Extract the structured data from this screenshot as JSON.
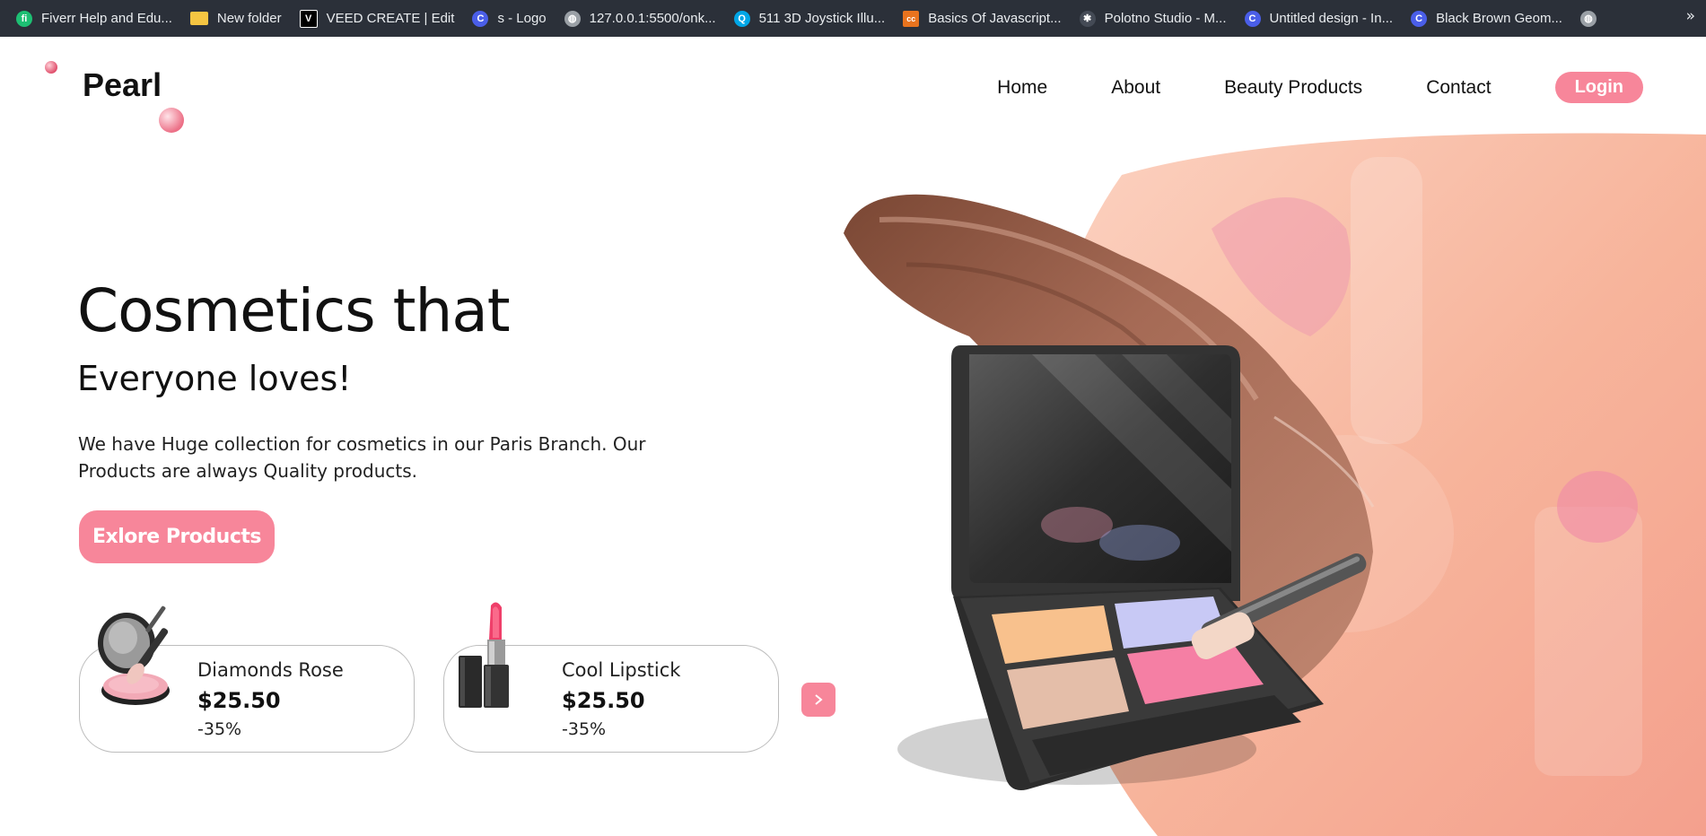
{
  "bookmarks": [
    {
      "label": "Fiverr Help and Edu...",
      "icon": "fiverr-icon",
      "color": "#1dbf73",
      "glyph": "fi"
    },
    {
      "label": "New folder",
      "icon": "folder-icon",
      "color": "#f5c542",
      "glyph": ""
    },
    {
      "label": "VEED CREATE | Edit",
      "icon": "veed-icon",
      "color": "#000000",
      "glyph": "V"
    },
    {
      "label": "s - Logo",
      "icon": "canva-icon",
      "color": "#4a5ee8",
      "glyph": "C"
    },
    {
      "label": "127.0.0.1:5500/onk...",
      "icon": "globe-icon",
      "color": "#9aa0a6",
      "glyph": ""
    },
    {
      "label": "511 3D Joystick Illu...",
      "icon": "search-site-icon",
      "color": "#00a6e6",
      "glyph": "Q"
    },
    {
      "label": "Basics Of Javascript...",
      "icon": "coursera-icon",
      "color": "#e8731e",
      "glyph": "cc"
    },
    {
      "label": "Polotno Studio - M...",
      "icon": "polotno-icon",
      "color": "#444a55",
      "glyph": "*"
    },
    {
      "label": "Untitled design - In...",
      "icon": "canva-icon",
      "color": "#4a5ee8",
      "glyph": "C"
    },
    {
      "label": "Black Brown Geom...",
      "icon": "canva-icon",
      "color": "#4a5ee8",
      "glyph": "C"
    },
    {
      "label": "",
      "icon": "globe-icon",
      "color": "#9aa0a6",
      "glyph": ""
    }
  ],
  "bookmarks_more": "»",
  "header": {
    "logo": "Pearl",
    "nav": [
      "Home",
      "About",
      "Beauty Products",
      "Contact"
    ],
    "login": "Login"
  },
  "hero": {
    "title": "Cosmetics that",
    "subtitle": "Everyone loves!",
    "description": "We have Huge collection for cosmetics in our Paris Branch. Our Products are always Quality products.",
    "cta": "Exlore Products"
  },
  "products": [
    {
      "name": "Diamonds Rose",
      "price": "$25.50",
      "discount": "-35%",
      "icon": "compact-powder-brush-icon"
    },
    {
      "name": "Cool Lipstick",
      "price": "$25.50",
      "discount": "-35%",
      "icon": "lipstick-icon"
    }
  ],
  "next_icon": "chevron-right-icon",
  "colors": {
    "accent": "#f7869a",
    "bookmarks_bar": "#2b3039",
    "peach_bg": "#f7b59a"
  }
}
